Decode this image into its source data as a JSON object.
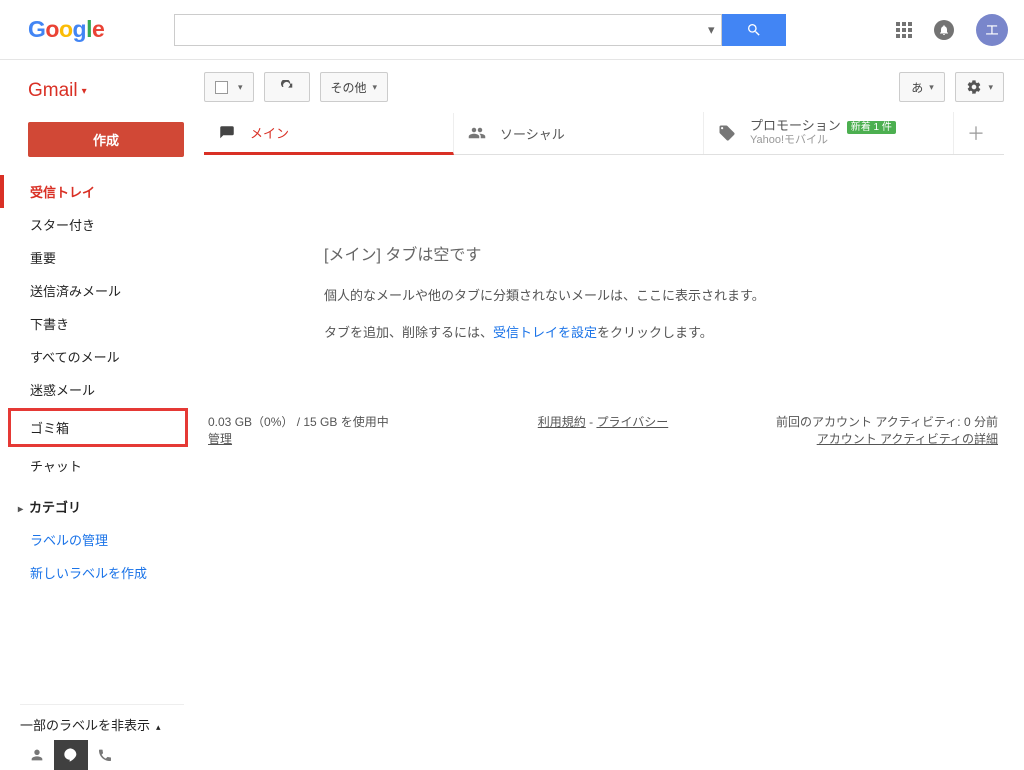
{
  "header": {
    "search_placeholder": "",
    "avatar_initial": "エ"
  },
  "sidebar": {
    "gmail_label": "Gmail",
    "compose": "作成",
    "items": [
      {
        "label": "受信トレイ",
        "active": true
      },
      {
        "label": "スター付き"
      },
      {
        "label": "重要"
      },
      {
        "label": "送信済みメール"
      },
      {
        "label": "下書き"
      },
      {
        "label": "すべてのメール"
      },
      {
        "label": "迷惑メール"
      },
      {
        "label": "ゴミ箱",
        "highlight": true
      },
      {
        "label": "チャット"
      }
    ],
    "category_header": "カテゴリ",
    "links": [
      {
        "label": "ラベルの管理"
      },
      {
        "label": "新しいラベルを作成"
      }
    ],
    "bottom_toggle": "一部のラベルを非表示"
  },
  "toolbar": {
    "other_label": "その他",
    "lang_label": "あ"
  },
  "tabs": {
    "main": "メイン",
    "social": "ソーシャル",
    "promo_title": "プロモーション",
    "promo_badge": "新着 1 件",
    "promo_sub": "Yahoo!モバイル"
  },
  "empty": {
    "title": "[メイン] タブは空です",
    "line1": "個人的なメールや他のタブに分類されないメールは、ここに表示されます。",
    "line2a": "タブを追加、削除するには、",
    "line2_link": "受信トレイを設定",
    "line2b": "をクリックします。"
  },
  "footer": {
    "storage1": "0.03 GB（0%） / 15 GB を使用中",
    "storage2": "管理",
    "terms": "利用規約",
    "sep": " - ",
    "privacy": "プライバシー",
    "activity1": "前回のアカウント アクティビティ: 0 分前",
    "activity2": "アカウント アクティビティの詳細"
  }
}
